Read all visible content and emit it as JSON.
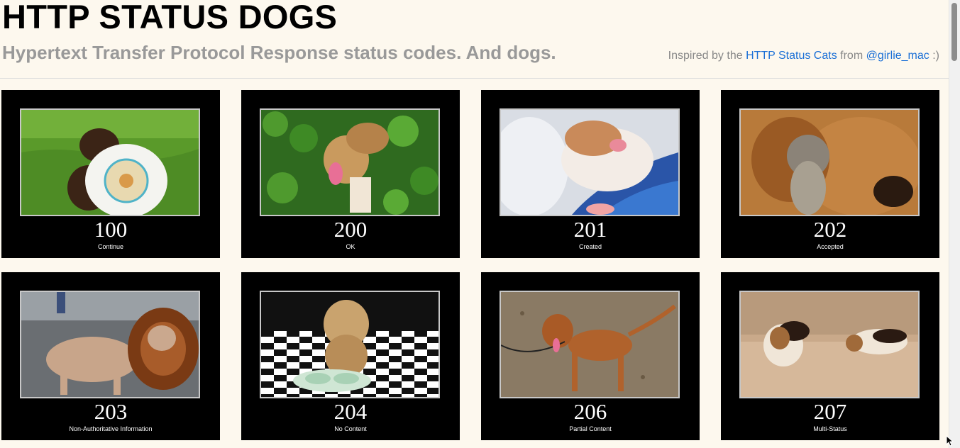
{
  "header": {
    "title": "HTTP STATUS DOGS",
    "subtitle": "Hypertext Transfer Protocol Response status codes. And dogs.",
    "credit": {
      "prefix": "Inspired by the",
      "link1": "HTTP Status Cats",
      "middle": "from",
      "link2": "@girlie_mac",
      "suffix": ":)"
    }
  },
  "cards": [
    {
      "code": "100",
      "label": "Continue",
      "icon": "puppy-with-frisbee-photo"
    },
    {
      "code": "200",
      "label": "OK",
      "icon": "dog-in-ivy-photo"
    },
    {
      "code": "201",
      "label": "Created",
      "icon": "sleeping-puppy-photo"
    },
    {
      "code": "202",
      "label": "Accepted",
      "icon": "dog-and-kitten-photo"
    },
    {
      "code": "203",
      "label": "Non-Authoritative Information",
      "icon": "dog-in-lion-costume-photo"
    },
    {
      "code": "204",
      "label": "No Content",
      "icon": "dog-with-empty-bowl-photo"
    },
    {
      "code": "206",
      "label": "Partial Content",
      "icon": "three-legged-dog-photo"
    },
    {
      "code": "207",
      "label": "Multi-Status",
      "icon": "two-beagles-photo"
    }
  ]
}
